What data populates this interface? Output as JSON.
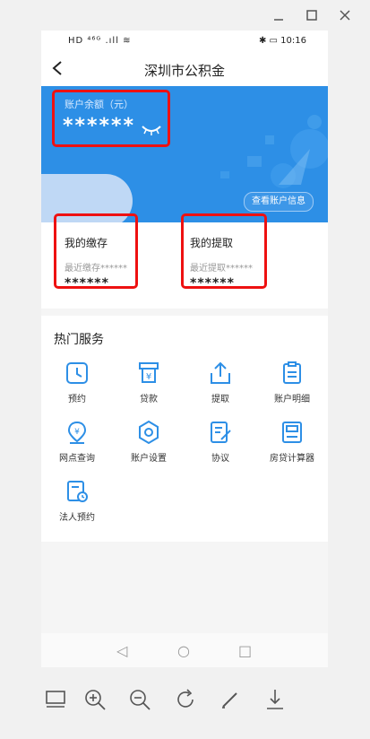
{
  "window": {
    "minimize_icon": "minimize-icon",
    "maximize_icon": "maximize-icon",
    "close_icon": "close-icon"
  },
  "status_bar": {
    "left_icons": "HD ⁴⁶ᴳ .ıll ≋",
    "right_text": "✱ ▭ 10:16"
  },
  "app_bar": {
    "title": "深圳市公积金",
    "back_icon": "chevron-left-icon"
  },
  "balance": {
    "label": "账户余额（元）",
    "value": "******",
    "toggle_icon": "eye-closed-icon"
  },
  "account_info_button": "查看账户信息",
  "deposit": {
    "title": "我的缴存",
    "recent": "最近缴存******",
    "value": "******"
  },
  "withdraw": {
    "title": "我的提取",
    "recent": "最近提取******",
    "value": "******"
  },
  "services": {
    "title": "热门服务",
    "items": [
      {
        "label": "预约",
        "icon": "clock-icon"
      },
      {
        "label": "贷款",
        "icon": "atm-loan-icon"
      },
      {
        "label": "提取",
        "icon": "upload-icon"
      },
      {
        "label": "账户明细",
        "icon": "clipboard-icon"
      },
      {
        "label": "网点查询",
        "icon": "map-pin-yuan-icon"
      },
      {
        "label": "账户设置",
        "icon": "hexagon-settings-icon"
      },
      {
        "label": "协议",
        "icon": "document-edit-icon"
      },
      {
        "label": "房贷计算器",
        "icon": "calculator-icon"
      },
      {
        "label": "法人预约",
        "icon": "calendar-clock-icon"
      }
    ]
  },
  "nav": {
    "back": "◁",
    "home": "○",
    "recents": "□"
  },
  "toolbar": {
    "icons": [
      "gallery-icon",
      "zoom-in-icon",
      "zoom-out-icon",
      "rotate-icon",
      "edit-icon",
      "download-icon"
    ]
  },
  "colors": {
    "accent": "#2d8fe6",
    "highlight": "#ee1111",
    "icon_blue": "#2d8fe6"
  }
}
